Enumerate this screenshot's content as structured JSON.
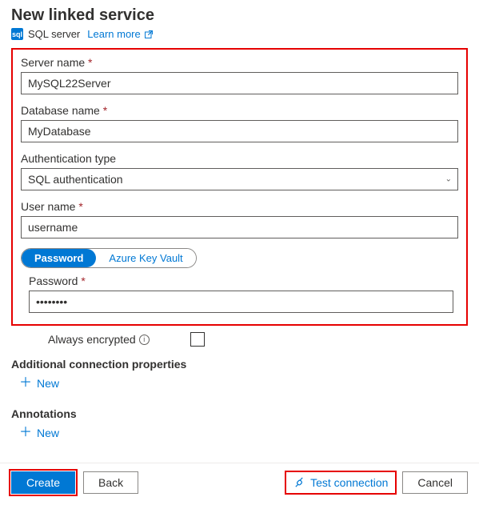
{
  "title": "New linked service",
  "subhead": {
    "service": "SQL server",
    "learn_more": "Learn more"
  },
  "fields": {
    "server_name": {
      "label": "Server name",
      "value": "MySQL22Server"
    },
    "database_name": {
      "label": "Database name",
      "value": "MyDatabase"
    },
    "auth_type": {
      "label": "Authentication type",
      "value": "SQL authentication"
    },
    "user_name": {
      "label": "User name",
      "value": "username"
    },
    "password": {
      "label": "Password",
      "value": "••••••••"
    }
  },
  "password_tabs": {
    "password": "Password",
    "akv": "Azure Key Vault"
  },
  "always_encrypted": "Always encrypted",
  "additional_props": "Additional connection properties",
  "annotations": "Annotations",
  "new_label": "New",
  "footer": {
    "create": "Create",
    "back": "Back",
    "test_connection": "Test connection",
    "cancel": "Cancel"
  }
}
